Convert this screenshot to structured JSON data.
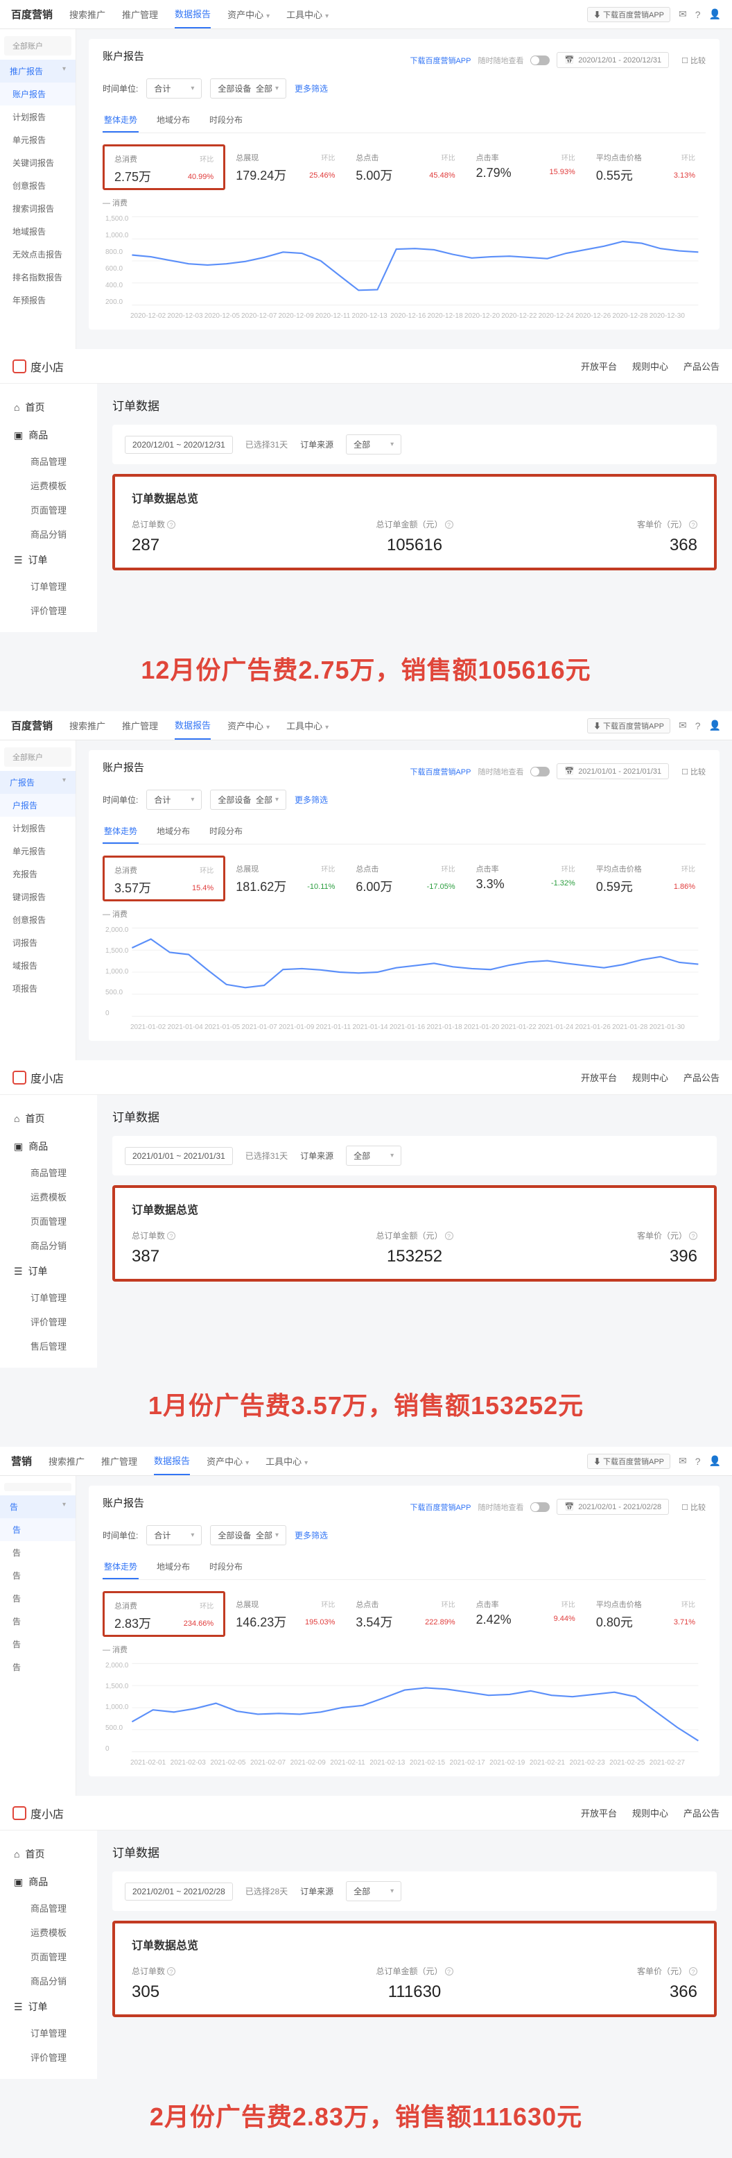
{
  "months": [
    {
      "topbar": {
        "brand": "百度营销",
        "brand_sub": "搜索推广",
        "tabs": [
          "推广管理",
          "数据报告",
          "资产中心",
          "工具中心"
        ],
        "app_link": "下载百度营销APP",
        "date_range": "2020/12/01 - 2020/12/31",
        "compare": "比较"
      },
      "sidebar": {
        "top": "全部账户",
        "group": "推广报告",
        "items": [
          "账户报告",
          "计划报告",
          "单元报告",
          "关键词报告",
          "创意报告",
          "搜索词报告",
          "地域报告",
          "无效点击报告",
          "排名指数报告",
          "年预报告"
        ]
      },
      "report": {
        "title": "账户报告",
        "filters": {
          "time_label": "时间单位:",
          "time_val": "合计",
          "device_label": "全部设备",
          "device_val": "全部",
          "more": "更多筛选"
        },
        "stat_tabs": [
          "整体走势",
          "地域分布",
          "时段分布"
        ],
        "metrics": [
          {
            "label": "总消费",
            "value": "2.75万",
            "sub": "40.99%",
            "dir": "up"
          },
          {
            "label": "总展现",
            "value": "179.24万",
            "sub": "25.46%",
            "dir": "up"
          },
          {
            "label": "总点击",
            "value": "5.00万",
            "sub": "45.48%",
            "dir": "up"
          },
          {
            "label": "点击率",
            "value": "2.79%",
            "sub": "15.93%",
            "dir": "up"
          },
          {
            "label": "平均点击价格",
            "value": "0.55元",
            "sub": "3.13%",
            "dir": "up"
          }
        ],
        "chart_label": "消费",
        "y_ticks": [
          "1,500.0",
          "1,000.0",
          "800.0",
          "600.0",
          "400.0",
          "200.0"
        ],
        "x_ticks": [
          "2020-12-02",
          "2020-12-03",
          "2020-12-05",
          "2020-12-07",
          "2020-12-09",
          "2020-12-11",
          "2020-12-13",
          "",
          "2020-12-16",
          "2020-12-18",
          "2020-12-20",
          "2020-12-22",
          "2020-12-24",
          "2020-12-26",
          "2020-12-28",
          "2020-12-30"
        ]
      },
      "store": {
        "brand": "度小店",
        "right": [
          "开放平台",
          "规则中心",
          "产品公告"
        ],
        "sidebar": {
          "g1": "首页",
          "g2": "商品",
          "g2_items": [
            "商品管理",
            "运费模板",
            "页面管理",
            "商品分销"
          ],
          "g3": "订单",
          "g3_items": [
            "订单管理",
            "评价管理"
          ]
        },
        "content": {
          "title": "订单数据",
          "filters": {
            "date": "2020/12/01 ~ 2020/12/31",
            "days": "已选择31天",
            "source_label": "订单来源",
            "source_val": "全部"
          },
          "ov_title": "订单数据总览",
          "metrics": [
            {
              "label": "总订单数",
              "value": "287"
            },
            {
              "label": "总订单金额（元）",
              "value": "105616"
            },
            {
              "label": "客单价（元）",
              "value": "368"
            }
          ]
        }
      },
      "caption": "12月份广告费2.75万，销售额105616元"
    },
    {
      "topbar": {
        "brand": "百度营销",
        "brand_sub": "搜索推广",
        "tabs": [
          "推广管理",
          "数据报告",
          "资产中心",
          "工具中心"
        ],
        "app_link": "下载百度营销APP",
        "date_range": "2021/01/01 - 2021/01/31",
        "compare": "比较"
      },
      "sidebar": {
        "top": "全部账户",
        "group": "广报告",
        "items": [
          "户报告",
          "计划报告",
          "单元报告",
          "充报告",
          "键词报告",
          "创意报告",
          "词报告",
          "域报告",
          "项报告"
        ]
      },
      "report": {
        "title": "账户报告",
        "filters": {
          "time_label": "时间单位:",
          "time_val": "合计",
          "device_label": "全部设备",
          "device_val": "全部",
          "more": "更多筛选"
        },
        "stat_tabs": [
          "整体走势",
          "地域分布",
          "时段分布"
        ],
        "metrics": [
          {
            "label": "总消费",
            "value": "3.57万",
            "sub": "15.4%",
            "dir": "up"
          },
          {
            "label": "总展现",
            "value": "181.62万",
            "sub": "-10.11%",
            "dir": "down"
          },
          {
            "label": "总点击",
            "value": "6.00万",
            "sub": "-17.05%",
            "dir": "down"
          },
          {
            "label": "点击率",
            "value": "3.3%",
            "sub": "-1.32%",
            "dir": "down"
          },
          {
            "label": "平均点击价格",
            "value": "0.59元",
            "sub": "1.86%",
            "dir": "up"
          }
        ],
        "chart_label": "消费",
        "y_ticks": [
          "2,000.0",
          "1,500.0",
          "1,000.0",
          "500.0",
          "0"
        ],
        "x_ticks": [
          "2021-01-02",
          "2021-01-04",
          "2021-01-05",
          "2021-01-07",
          "2021-01-09",
          "2021-01-11",
          "2021-01-14",
          "2021-01-16",
          "2021-01-18",
          "2021-01-20",
          "2021-01-22",
          "2021-01-24",
          "2021-01-26",
          "2021-01-28",
          "2021-01-30"
        ]
      },
      "store": {
        "brand": "度小店",
        "right": [
          "开放平台",
          "规则中心",
          "产品公告"
        ],
        "sidebar": {
          "g1": "首页",
          "g2": "商品",
          "g2_items": [
            "商品管理",
            "运费模板",
            "页面管理",
            "商品分销"
          ],
          "g3": "订单",
          "g3_items": [
            "订单管理",
            "评价管理",
            "售后管理"
          ]
        },
        "content": {
          "title": "订单数据",
          "filters": {
            "date": "2021/01/01 ~ 2021/01/31",
            "days": "已选择31天",
            "source_label": "订单来源",
            "source_val": "全部"
          },
          "ov_title": "订单数据总览",
          "metrics": [
            {
              "label": "总订单数",
              "value": "387"
            },
            {
              "label": "总订单金额（元）",
              "value": "153252"
            },
            {
              "label": "客单价（元）",
              "value": "396"
            }
          ]
        }
      },
      "caption": "1月份广告费3.57万，销售额153252元"
    },
    {
      "topbar": {
        "brand": "营销",
        "brand_sub": "搜索推广",
        "tabs": [
          "推广管理",
          "数据报告",
          "资产中心",
          "工具中心"
        ],
        "app_link": "下载百度营销APP",
        "date_range": "2021/02/01 - 2021/02/28",
        "compare": "比较"
      },
      "sidebar": {
        "top": "",
        "group": "告",
        "items": [
          "告",
          "告",
          "告",
          "告",
          "告",
          "告",
          "告"
        ]
      },
      "report": {
        "title": "账户报告",
        "filters": {
          "time_label": "时间单位:",
          "time_val": "合计",
          "device_label": "全部设备",
          "device_val": "全部",
          "more": "更多筛选"
        },
        "stat_tabs": [
          "整体走势",
          "地域分布",
          "时段分布"
        ],
        "metrics": [
          {
            "label": "总消费",
            "value": "2.83万",
            "sub": "234.66%",
            "dir": "up"
          },
          {
            "label": "总展现",
            "value": "146.23万",
            "sub": "195.03%",
            "dir": "up"
          },
          {
            "label": "总点击",
            "value": "3.54万",
            "sub": "222.89%",
            "dir": "up"
          },
          {
            "label": "点击率",
            "value": "2.42%",
            "sub": "9.44%",
            "dir": "up"
          },
          {
            "label": "平均点击价格",
            "value": "0.80元",
            "sub": "3.71%",
            "dir": "up"
          }
        ],
        "chart_label": "消费",
        "y_ticks": [
          "2,000.0",
          "1,500.0",
          "1,000.0",
          "500.0",
          "0"
        ],
        "x_ticks": [
          "2021-02-01",
          "2021-02-03",
          "2021-02-05",
          "2021-02-07",
          "2021-02-09",
          "2021-02-11",
          "2021-02-13",
          "2021-02-15",
          "2021-02-17",
          "2021-02-19",
          "2021-02-21",
          "2021-02-23",
          "2021-02-25",
          "2021-02-27"
        ]
      },
      "store": {
        "brand": "度小店",
        "right": [
          "开放平台",
          "规则中心",
          "产品公告"
        ],
        "sidebar": {
          "g1": "首页",
          "g2": "商品",
          "g2_items": [
            "商品管理",
            "运费模板",
            "页面管理",
            "商品分销"
          ],
          "g3": "订单",
          "g3_items": [
            "订单管理",
            "评价管理"
          ]
        },
        "content": {
          "title": "订单数据",
          "filters": {
            "date": "2021/02/01 ~ 2021/02/28",
            "days": "已选择28天",
            "source_label": "订单来源",
            "source_val": "全部"
          },
          "ov_title": "订单数据总览",
          "metrics": [
            {
              "label": "总订单数",
              "value": "305"
            },
            {
              "label": "总订单金额（元）",
              "value": "111630"
            },
            {
              "label": "客单价（元）",
              "value": "366"
            }
          ]
        }
      },
      "caption": "2月份广告费2.83万，销售额111630元"
    }
  ],
  "chart_data": [
    {
      "type": "line",
      "title": "消费",
      "ylabel": "消费 (元)",
      "ylim": [
        0,
        1500
      ],
      "x": [
        "12-01",
        "12-02",
        "12-03",
        "12-04",
        "12-05",
        "12-06",
        "12-07",
        "12-08",
        "12-09",
        "12-10",
        "12-11",
        "12-12",
        "12-13",
        "12-14",
        "12-15",
        "12-16",
        "12-17",
        "12-18",
        "12-19",
        "12-20",
        "12-21",
        "12-22",
        "12-23",
        "12-24",
        "12-25",
        "12-26",
        "12-27",
        "12-28",
        "12-29",
        "12-30",
        "12-31"
      ],
      "series": [
        {
          "name": "消费",
          "values": [
            850,
            820,
            760,
            700,
            680,
            700,
            740,
            810,
            900,
            880,
            750,
            500,
            250,
            260,
            950,
            960,
            940,
            860,
            800,
            820,
            830,
            810,
            790,
            880,
            940,
            1000,
            1080,
            1050,
            960,
            920,
            900
          ]
        }
      ]
    },
    {
      "type": "line",
      "title": "消费",
      "ylabel": "消费 (元)",
      "ylim": [
        0,
        2000
      ],
      "x": [
        "01-01",
        "01-02",
        "01-03",
        "01-04",
        "01-05",
        "01-06",
        "01-07",
        "01-08",
        "01-09",
        "01-10",
        "01-11",
        "01-12",
        "01-13",
        "01-14",
        "01-15",
        "01-16",
        "01-17",
        "01-18",
        "01-19",
        "01-20",
        "01-21",
        "01-22",
        "01-23",
        "01-24",
        "01-25",
        "01-26",
        "01-27",
        "01-28",
        "01-29",
        "01-30",
        "01-31"
      ],
      "series": [
        {
          "name": "消费",
          "values": [
            1550,
            1750,
            1450,
            1400,
            1050,
            720,
            650,
            700,
            1060,
            1080,
            1050,
            1000,
            980,
            1000,
            1100,
            1150,
            1200,
            1120,
            1080,
            1060,
            1160,
            1230,
            1260,
            1200,
            1150,
            1100,
            1170,
            1280,
            1350,
            1220,
            1180
          ]
        }
      ]
    },
    {
      "type": "line",
      "title": "消费",
      "ylabel": "消费 (元)",
      "ylim": [
        0,
        2000
      ],
      "x": [
        "02-01",
        "02-02",
        "02-03",
        "02-04",
        "02-05",
        "02-06",
        "02-07",
        "02-08",
        "02-09",
        "02-10",
        "02-11",
        "02-12",
        "02-13",
        "02-14",
        "02-15",
        "02-16",
        "02-17",
        "02-18",
        "02-19",
        "02-20",
        "02-21",
        "02-22",
        "02-23",
        "02-24",
        "02-25",
        "02-26",
        "02-27",
        "02-28"
      ],
      "series": [
        {
          "name": "消费",
          "values": [
            680,
            950,
            900,
            980,
            1100,
            920,
            850,
            870,
            850,
            900,
            1000,
            1050,
            1220,
            1400,
            1450,
            1420,
            1350,
            1280,
            1300,
            1380,
            1280,
            1250,
            1300,
            1350,
            1250,
            900,
            550,
            250
          ]
        }
      ]
    }
  ]
}
